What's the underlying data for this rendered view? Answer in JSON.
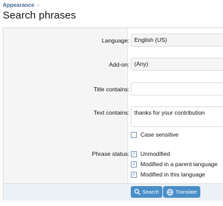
{
  "breadcrumb": {
    "item": "Appearance",
    "separator": "›"
  },
  "page": {
    "title": "Search phrases"
  },
  "form": {
    "language": {
      "label": "Language:",
      "value": "English (US)"
    },
    "addon": {
      "label": "Add-on:",
      "value": "(Any)"
    },
    "title_contains": {
      "label": "Title contains:",
      "value": ""
    },
    "text_contains": {
      "label": "Text contains:",
      "value": "thanks for your contribution"
    },
    "case_sensitive": {
      "label": "Case sensitive",
      "checked": false
    },
    "phrase_status": {
      "label": "Phrase status:",
      "options": [
        {
          "label": "Unmodified",
          "checked": true
        },
        {
          "label": "Modified in a parent language",
          "checked": true
        },
        {
          "label": "Modified in this language",
          "checked": true
        }
      ]
    }
  },
  "buttons": {
    "search": "Search",
    "translate": "Translate"
  },
  "colors": {
    "accent": "#4a8ec8",
    "link": "#47698f"
  }
}
